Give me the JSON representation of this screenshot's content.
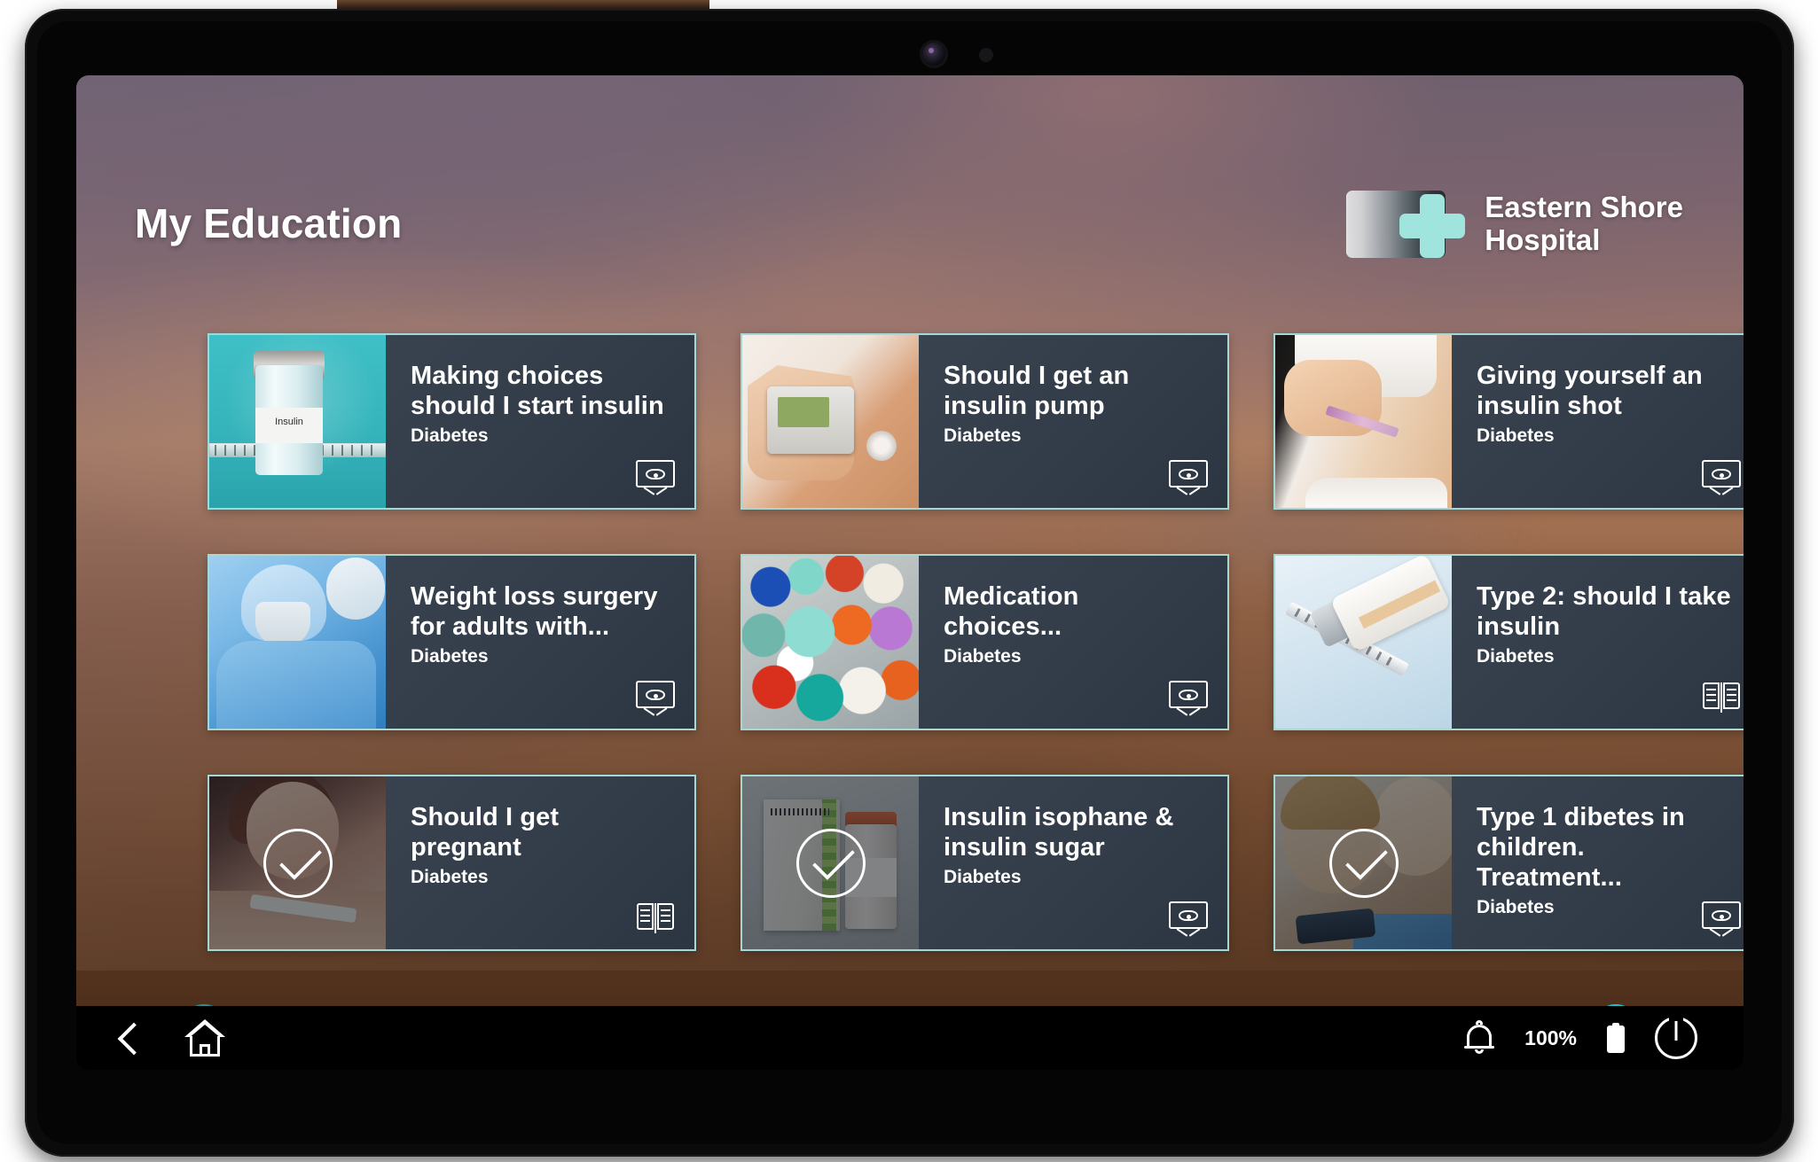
{
  "header": {
    "page_title": "My Education",
    "logo": {
      "line1": "Eastern Shore",
      "line2": "Hospital",
      "cross_color": "#9fe4dd"
    }
  },
  "theme": {
    "card_border": "#a5d8d4",
    "card_bg": "#333f4d",
    "accent_teal": "#1cc3c9",
    "accent_teal_dim": "#2f8f92",
    "navbar_bg": "#000000"
  },
  "cards": [
    {
      "title": "Making choices should I start insulin",
      "category": "Diabetes",
      "media_icon": "video-icon",
      "completed": false,
      "thumb": "insulin-vial-image"
    },
    {
      "title": "Should I get an insulin pump",
      "category": "Diabetes",
      "media_icon": "video-icon",
      "completed": false,
      "thumb": "insulin-pump-image"
    },
    {
      "title": "Giving yourself an insulin shot",
      "category": "Diabetes",
      "media_icon": "video-icon",
      "completed": false,
      "thumb": "insulin-injection-image"
    },
    {
      "title": "Weight loss surgery for adults with...",
      "category": "Diabetes",
      "media_icon": "video-icon",
      "completed": false,
      "thumb": "surgeons-image"
    },
    {
      "title": "Medication choices...",
      "category": "Diabetes",
      "media_icon": "video-icon",
      "completed": false,
      "thumb": "pills-image"
    },
    {
      "title": "Type 2: should I take insulin",
      "category": "Diabetes",
      "media_icon": "book-icon",
      "completed": false,
      "thumb": "insulin-syringe-image"
    },
    {
      "title": "Should I get pregnant",
      "category": "Diabetes",
      "media_icon": "book-icon",
      "completed": true,
      "thumb": "pregnancy-test-image"
    },
    {
      "title": "Insulin isophane & insulin sugar",
      "category": "Diabetes",
      "media_icon": "video-icon",
      "completed": true,
      "thumb": "insulin-box-image"
    },
    {
      "title": "Type 1 dibetes in children. Treatment...",
      "category": "Diabetes",
      "media_icon": "video-icon",
      "completed": true,
      "thumb": "children-glucose-meter-image"
    }
  ],
  "pager": {
    "prev_icon": "chevron-left-icon",
    "next_icon": "chevron-right-icon",
    "dots": [
      {
        "active": true
      },
      {
        "active": false
      }
    ]
  },
  "navbar": {
    "back_icon": "back-chevron-icon",
    "home_icon": "home-icon",
    "bell_icon": "bell-icon",
    "battery_percent": "100%",
    "battery_icon": "battery-full-icon",
    "power_icon": "power-icon"
  }
}
